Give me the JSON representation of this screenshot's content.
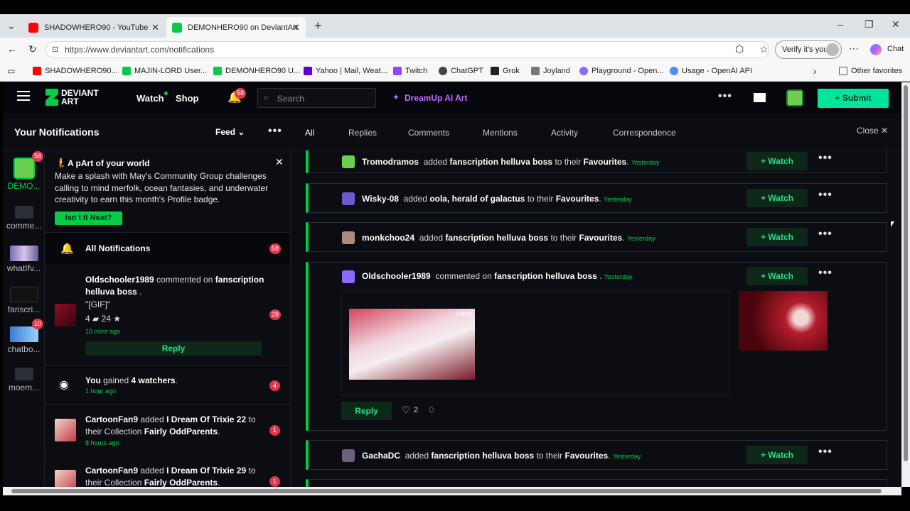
{
  "browser": {
    "tabs": [
      {
        "title": "SHADOWHERO90 - YouTube",
        "color": "#ff0000"
      },
      {
        "title": "DEMONHERO90 on DeviantArt",
        "color": "#05cc47"
      }
    ],
    "url": "https://www.deviantart.com/notifications",
    "verify": "Verify it's you",
    "chat": "Chat",
    "bookmarks": [
      "SHADOWHERO90...",
      "MAJIN-LORD User...",
      "DEMONHERO90 U...",
      "Yahoo | Mail, Weat...",
      "Twitch",
      "ChatGPT",
      "Grok",
      "Joyland",
      "Playground - Open...",
      "Usage - OpenAI API"
    ],
    "other_favorites": "Other favorites"
  },
  "nav": {
    "logo": "DEVIANT ART",
    "watch": "Watch",
    "shop": "Shop",
    "bell_count": "58",
    "search_placeholder": "Search",
    "dreamup": "DreamUp AI Art",
    "submit": "Submit"
  },
  "subnav": {
    "title": "Your Notifications",
    "feed": "Feed",
    "tabs": [
      "All",
      "Replies",
      "Comments",
      "Mentions",
      "Activity",
      "Correspondence"
    ],
    "close": "Close"
  },
  "rail": [
    {
      "label": "DEMO...",
      "badge": "58"
    },
    {
      "label": "comme...",
      "badge": ""
    },
    {
      "label": "whatIfv...",
      "badge": ""
    },
    {
      "label": "fanscri...",
      "badge": ""
    },
    {
      "label": "chatbo...",
      "badge": "10"
    },
    {
      "label": "moem...",
      "badge": ""
    }
  ],
  "banner": {
    "title": "A pArt of your world",
    "text": "Make a splash with May's Community Group challenges calling to mind merfolk, ocean fantasies, and underwater creativity to earn this month's Profile badge.",
    "button": "Isn't It Neat?"
  },
  "all_notifications": {
    "label": "All Notifications",
    "count": "58"
  },
  "panel_items": [
    {
      "user": "Oldschooler1989",
      "action": "commented on",
      "target": "fanscription helluva boss",
      "quote": "\"[GIF]\"",
      "comments": "4",
      "favs": "24",
      "time": "10 mins ago",
      "count": "28",
      "reply": "Reply"
    },
    {
      "user": "You",
      "action": "gained",
      "target": "4 watchers",
      "time": "1 hour ago",
      "count": "4"
    },
    {
      "user": "CartoonFan9",
      "action": "added",
      "target": "I Dream Of Trixie 22",
      "mid": "to their Collection",
      "collection": "Fairly OddParents",
      "time": "8 hours ago",
      "count": "1"
    },
    {
      "user": "CartoonFan9",
      "action": "added",
      "target": "I Dream Of Trixie 29",
      "mid": "to their Collection",
      "collection": "Fairly OddParents",
      "count": "1"
    }
  ],
  "feed": [
    {
      "user": "Tromodramos",
      "action": "added",
      "target": "fanscription helluva boss",
      "suffix": "to their",
      "list": "Favourites",
      "time": "Yesterday"
    },
    {
      "user": "Wisky-08",
      "action": "added",
      "target": "oola, herald of galactus",
      "suffix": "to their",
      "list": "Favourites",
      "time": "Yesterday"
    },
    {
      "user": "monkchoo24",
      "action": "added",
      "target": "fanscription helluva boss",
      "suffix": "to their",
      "list": "Favourites",
      "time": "Yesterday"
    },
    {
      "user": "Oldschooler1989",
      "action": "commented on",
      "target": "fanscription helluva boss",
      "suffix": "",
      "list": "",
      "time": "Yesterday"
    },
    {
      "user": "GachaDC",
      "action": "added",
      "target": "fanscription helluva boss",
      "suffix": "to their",
      "list": "Favourites",
      "time": "Yesterday"
    }
  ],
  "watch_label": "+ Watch",
  "comment_card": {
    "reply": "Reply",
    "likes": "2",
    "gif_watermark": "prime"
  }
}
